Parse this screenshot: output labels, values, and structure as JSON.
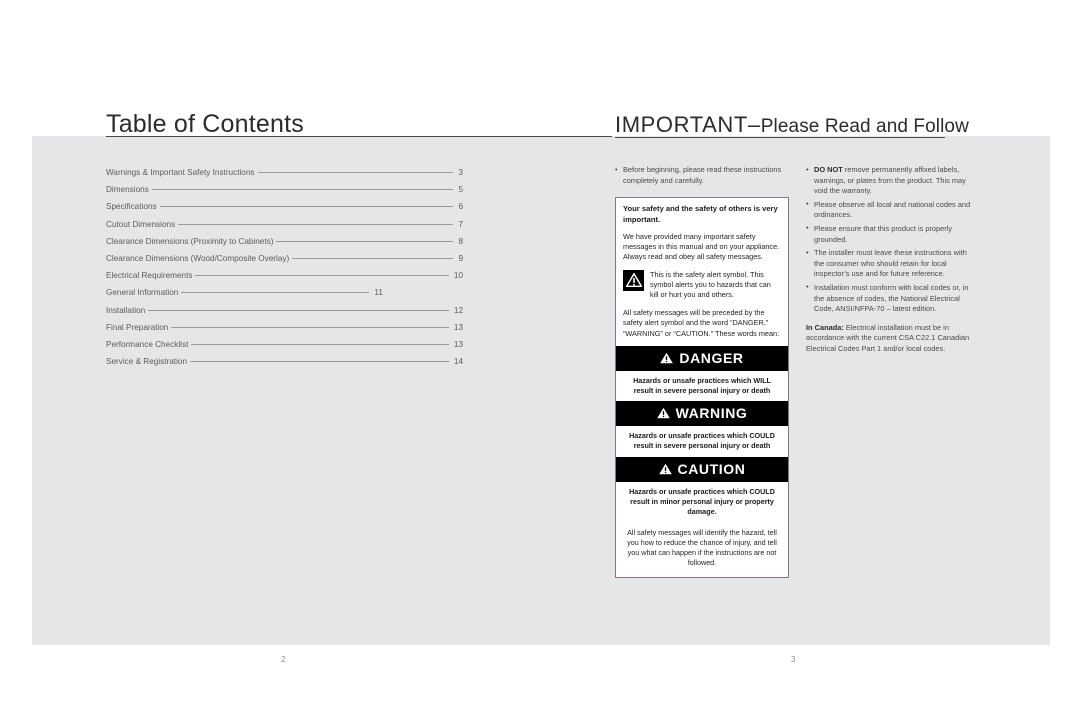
{
  "spread": {
    "background_color": "#e5e6e7"
  },
  "left_page": {
    "title": "Table of Contents",
    "folio": "2",
    "toc": [
      {
        "label": "Warnings & Important Safety Instructions",
        "page": "3"
      },
      {
        "label": "Dimensions",
        "page": "5"
      },
      {
        "label": "Specifications",
        "page": "6"
      },
      {
        "label": "Cutout Dimensions",
        "page": "7"
      },
      {
        "label": "Clearance Dimensions (Proximity to Cabinets)",
        "page": "8"
      },
      {
        "label": "Clearance Dimensions (Wood/Composite Overlay)",
        "page": "9"
      },
      {
        "label": "Electrical Requirements",
        "page": "10"
      },
      {
        "label": "General Information",
        "page": "11"
      },
      {
        "label": "Installation",
        "page": "12"
      },
      {
        "label": "Final Preparation",
        "page": "13"
      },
      {
        "label": "Performance Checklist",
        "page": "13"
      },
      {
        "label": "Service & Registration",
        "page": "14"
      }
    ]
  },
  "right_page": {
    "title_main": "IMPORTANT–",
    "title_sub": "Please Read and Follow",
    "folio": "3",
    "column_a": {
      "intro_bullets": [
        "Before beginning, please read these instructions completely and carefully."
      ],
      "safety_panel": {
        "border_color": "#8d6f8e",
        "title": "Your safety and the safety of others is very important.",
        "paragraph_1": "We have provided many important safety messages in this manual and on your appliance. Always read and obey all safety messages.",
        "alert_symbol_name": "safety-alert-symbol",
        "alert_symbol_text": "This is the safety alert symbol. This symbol alerts you to hazards that can kill or hurt you and others.",
        "paragraph_2": "All safety messages will be preceded by the safety alert symbol and the word “DANGER,” “WARNING” or “CAUTION.” These words mean:",
        "signal_words": [
          {
            "word": "DANGER",
            "body": "Hazards or unsafe practices which WILL result in severe personal injury or death"
          },
          {
            "word": "WARNING",
            "body": "Hazards or unsafe practices which COULD result in severe personal injury or death"
          },
          {
            "word": "CAUTION",
            "body": "Hazards or unsafe practices which COULD result in minor personal injury or property damage."
          }
        ],
        "closing_note": "All safety messages will identify the hazard, tell you how to reduce the chance of injury, and tell you what can happen if the instructions are not followed."
      }
    },
    "column_b": {
      "bullets": [
        {
          "lead": "DO NOT",
          "text": " remove permanently affixed labels, warnings, or plates from the product. This may void the warranty."
        },
        {
          "lead": "",
          "text": "Please observe all local and national codes and ordinances."
        },
        {
          "lead": "",
          "text": "Please ensure that this product is properly grounded."
        },
        {
          "lead": "",
          "text": "The installer must leave these instructions with the consumer who should retain for local inspector’s use and for future reference."
        },
        {
          "lead": "",
          "text": "Installation must conform with local codes or, in the absence of codes, the National Electrical Code, ANSI/NFPA-70 – latest edition."
        }
      ],
      "in_canada_lead": "In Canada:",
      "in_canada_text": " Electrical installation must be in accordance with the current CSA C22.1 Canadian Electrical Codes Part 1 and/or local codes."
    }
  }
}
